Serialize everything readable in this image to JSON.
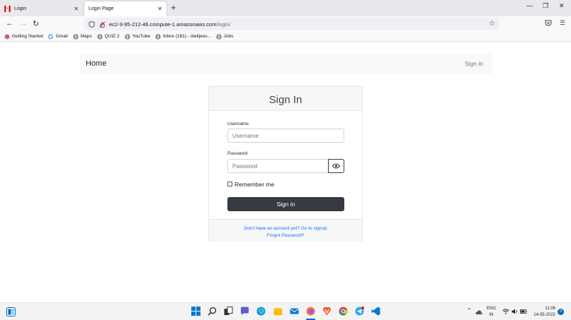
{
  "browser": {
    "tabs": [
      {
        "title": "Login",
        "active": false
      },
      {
        "title": "Login Page",
        "active": true
      }
    ],
    "new_tab_symbol": "+",
    "url": {
      "host": "ec2-3-95-212-46.compute-1.amazonaws.com",
      "path": "/login/"
    },
    "bookmarks": [
      {
        "label": "Getting Started",
        "icon": "firefox-icon"
      },
      {
        "label": "Gmail",
        "icon": "google-icon"
      },
      {
        "label": "Maps",
        "icon": "globe-icon"
      },
      {
        "label": "QUIZ 2",
        "icon": "globe-icon"
      },
      {
        "label": "YouTube",
        "icon": "globe-icon"
      },
      {
        "label": "Inbox (181) - oletijeev...",
        "icon": "globe-icon"
      },
      {
        "label": "Jobs",
        "icon": "globe-icon"
      }
    ]
  },
  "site_nav": {
    "brand": "Home",
    "signin": "Sign in"
  },
  "form": {
    "heading": "Sign In",
    "username_label": "Username",
    "username_placeholder": "Username",
    "password_label": "Password",
    "password_placeholder": "Password",
    "remember_label": "Remember me",
    "remember_checked": false,
    "submit_label": "Sign in",
    "signup_text": "Don't have an account yet? Go to signup",
    "forgot_text": "Forgot Password?"
  },
  "taskbar": {
    "lang": "ENG",
    "region": "IN",
    "time": "11:06",
    "date": "14-05-2022",
    "notifications": "3"
  },
  "colors": {
    "primary_dark": "#343a40",
    "link": "#0d6efd",
    "navbar_bg": "#f8f9fa"
  }
}
